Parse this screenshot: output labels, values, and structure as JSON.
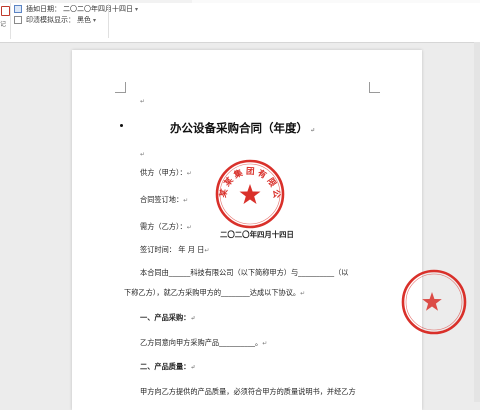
{
  "ribbon": {
    "tool_label": "记",
    "line1": {
      "label": "插如日期：",
      "value": "二〇二〇年四月十四日"
    },
    "line2": {
      "label": "印渍模拟显示：",
      "value": "黑色"
    }
  },
  "document": {
    "title": "办公设备采购合同（年度）",
    "party_a": "供方（甲方）：",
    "sign_place": "合同签订地：",
    "party_b": "需方（乙方）：",
    "sign_time": "签订时间：   年  月  日",
    "seal_date": "二〇二〇年四月十四日",
    "seal_text": "某某集团有限公司",
    "paragraph1_line1": "本合同由______科技有限公司（以下简称甲方）与__________（以",
    "paragraph1_line2": "下称乙方），就乙方采购甲方的________达成以下协议。",
    "heading1": "一、产品采购：",
    "item1": "乙方同意向甲方采购产品__________。",
    "heading2": "二、产品质量：",
    "item2": "甲方向乙方提供的产品质量，必须符合甲方的质量说明书，并经乙方"
  },
  "colors": {
    "seal_red": "#d9302a"
  }
}
